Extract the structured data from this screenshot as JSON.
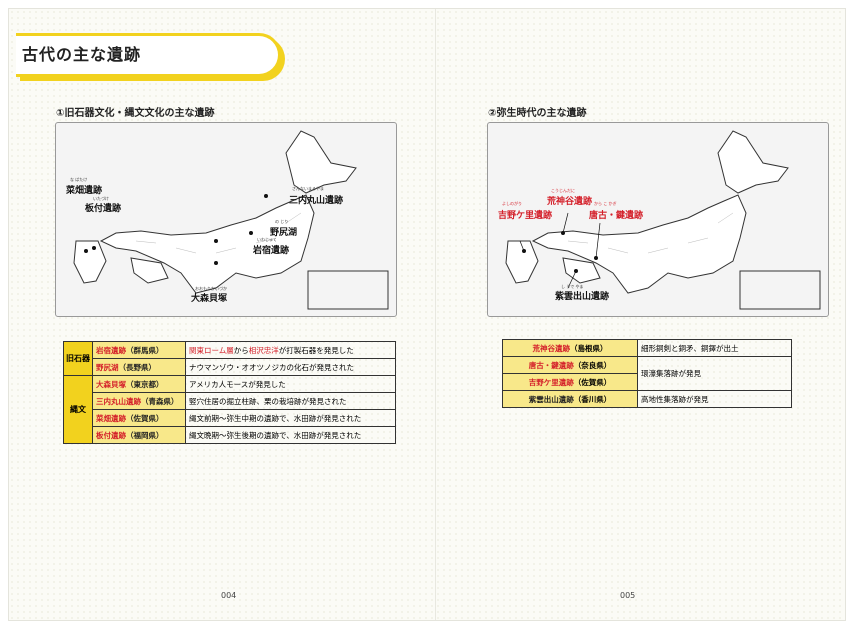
{
  "page_title": "古代の主な遺跡",
  "left": {
    "section_title": "①旧石器文化・縄文文化の主な遺跡",
    "map_labels": {
      "hatahata": "菜畑遺跡",
      "hatahata_ruby": "な ばたけ",
      "itazuke": "板付遺跡",
      "itazuke_ruby": "いたづけ",
      "sannai": "三内丸山遺跡",
      "sannai_ruby": "さんないまるやま",
      "nojiri": "野尻湖",
      "nojiri_ruby": "の じり",
      "iwajuku": "岩宿遺跡",
      "iwajuku_ruby": "いわじゅく",
      "omori": "大森貝塚",
      "omori_ruby": "おおもりかいづか"
    },
    "era1": "旧石器",
    "era2": "縄文",
    "rows": [
      {
        "name": "岩宿遺跡",
        "pref": "（群馬県）",
        "d1": "関東ローム層",
        "d2": "から",
        "d3": "相沢忠洋",
        "d4": "が打製石器を発見した"
      },
      {
        "name": "野尻湖",
        "pref": "（長野県）",
        "desc": "ナウマンゾウ・オオツノジカの化石が発見された"
      },
      {
        "name": "大森貝塚",
        "pref": "（東京都）",
        "desc": "アメリカ人モースが発見した"
      },
      {
        "name": "三内丸山遺跡",
        "pref": "（青森県）",
        "desc": "竪穴住居の掘立柱跡、栗の栽培跡が発見された"
      },
      {
        "name": "菜畑遺跡",
        "pref": "（佐賀県）",
        "desc": "縄文前期〜弥生中期の遺跡で、水田跡が発見された"
      },
      {
        "name": "板付遺跡",
        "pref": "（福岡県）",
        "desc": "縄文晩期〜弥生後期の遺跡で、水田跡が発見された"
      }
    ],
    "page_number": "004"
  },
  "right": {
    "section_title": "②弥生時代の主な遺跡",
    "map_labels": {
      "kojindani": "荒神谷遺跡",
      "kojindani_ruby": "こうじんだに",
      "yoshinogari": "吉野ケ里遺跡",
      "yoshinogari_ruby": "よしのがり",
      "karako": "唐古・鍵遺跡",
      "karako_ruby": "から こ  かぎ",
      "shiude": "紫雲出山遺跡",
      "shiude_ruby": "し うで やま"
    },
    "rows": [
      {
        "name": "荒神谷遺跡",
        "pref": "（島根県）",
        "desc": "細形銅剣と銅矛、銅鐸が出土"
      },
      {
        "name": "唐古・鍵遺跡",
        "pref": "（奈良県）",
        "desc": "環濠集落跡が発見"
      },
      {
        "name": "吉野ケ里遺跡",
        "pref": "（佐賀県）"
      },
      {
        "name": "紫雲出山遺跡",
        "pref": "（香川県）",
        "desc": "高地性集落跡が発見"
      }
    ],
    "page_number": "005"
  },
  "colors": {
    "accent": "#f2d21e",
    "highlight": "#d4202a",
    "cell": "#f8e88a"
  }
}
